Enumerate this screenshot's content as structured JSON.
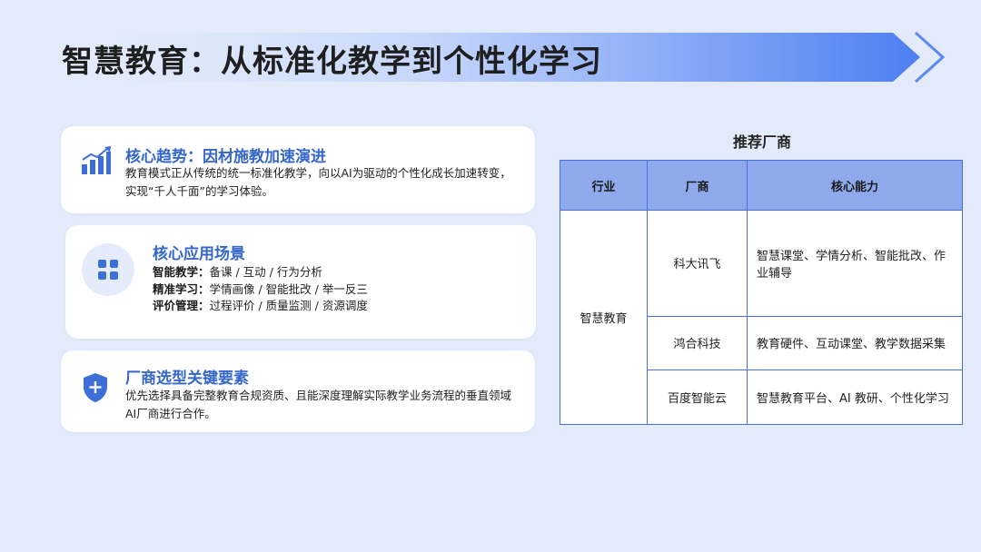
{
  "title": "智慧教育：从标准化教学到个性化学习",
  "colors": {
    "accent": "#3567c9",
    "banner": "#4a7bf0",
    "table_header": "#8ea9ec",
    "background": "#e3ebfb"
  },
  "trend": {
    "icon": "bar-chart-growth-icon",
    "title": "核心趋势：因材施教加速演进",
    "body": "教育模式正从传统的统一标准化教学，向以AI为驱动的个性化成长加速转变，实现“千人千面”的学习体验。"
  },
  "scenarios": {
    "icon": "grid-apps-icon",
    "title": "核心应用场景",
    "items": [
      {
        "label": "智能教学：",
        "text": "备课 / 互动 / 行为分析"
      },
      {
        "label": "精准学习：",
        "text": "学情画像 / 智能批改 / 举一反三"
      },
      {
        "label": "评价管理：",
        "text": "过程评价 / 质量监测 / 资源调度"
      }
    ]
  },
  "selection": {
    "icon": "shield-plus-icon",
    "title": "厂商选型关键要素",
    "body": "优先选择具备完整教育合规资质、且能深度理解实际教学业务流程的垂直领域AI厂商进行合作。"
  },
  "vendor_table": {
    "title": "推荐厂商",
    "headers": [
      "行业",
      "厂商",
      "核心能力"
    ],
    "industry": "智慧教育",
    "rows": [
      {
        "vendor": "科大讯飞",
        "capability": "智慧课堂、学情分析、智能批改、作业辅导"
      },
      {
        "vendor": "鸿合科技",
        "capability": "教育硬件、互动课堂、教学数据采集"
      },
      {
        "vendor": "百度智能云",
        "capability": "智慧教育平台、AI 教研、个性化学习"
      }
    ]
  }
}
